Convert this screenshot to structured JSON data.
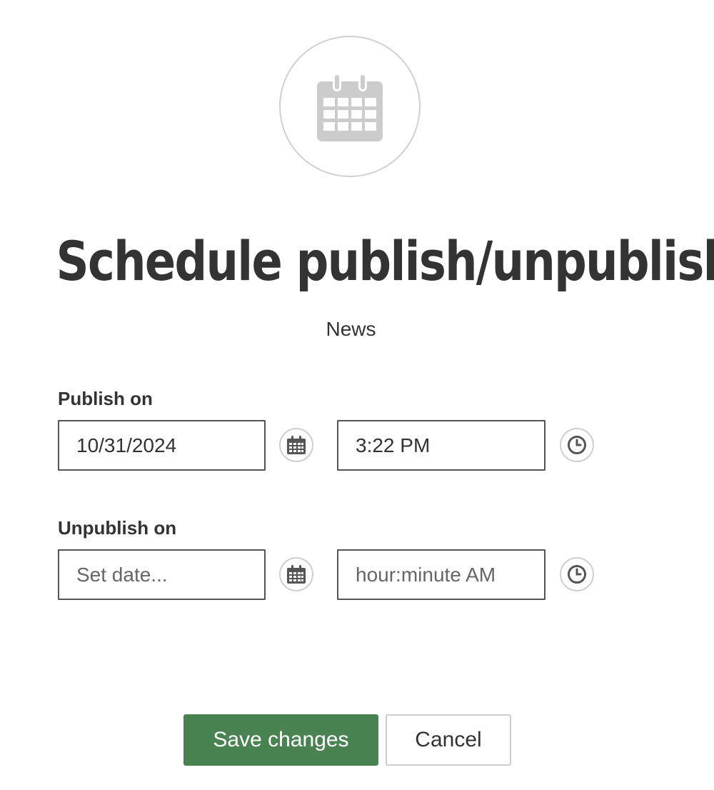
{
  "header": {
    "icon": "calendar-icon",
    "title": "Schedule publish/unpublish",
    "subtitle": "News"
  },
  "publish": {
    "label": "Publish on",
    "date_value": "10/31/2024",
    "date_placeholder": "Set date...",
    "time_value": "3:22 PM",
    "time_placeholder": "hour:minute AM",
    "date_button_icon": "calendar-icon",
    "time_button_icon": "clock-icon"
  },
  "unpublish": {
    "label": "Unpublish on",
    "date_value": "",
    "date_placeholder": "Set date...",
    "time_value": "",
    "time_placeholder": "hour:minute AM",
    "date_button_icon": "calendar-icon",
    "time_button_icon": "clock-icon"
  },
  "actions": {
    "save_label": "Save changes",
    "cancel_label": "Cancel"
  },
  "colors": {
    "primary_button": "#4a8352",
    "text": "#333333",
    "icon_gray": "#cccccc"
  }
}
